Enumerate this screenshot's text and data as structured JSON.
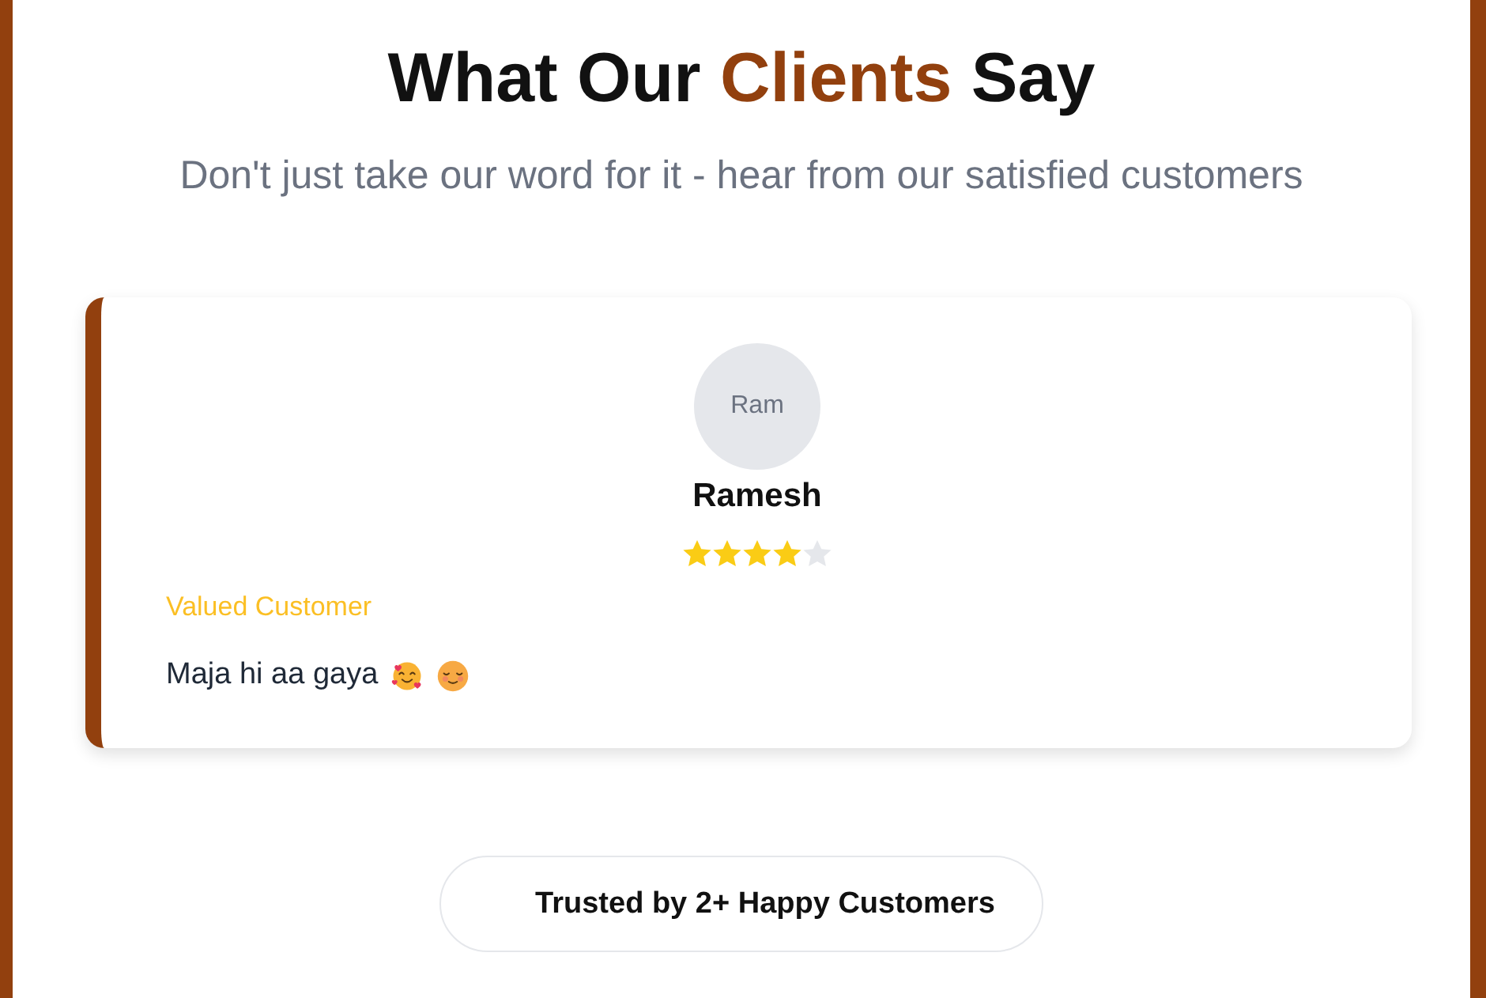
{
  "heading": {
    "start": "What Our",
    "highlight": "Clients",
    "end": "Say"
  },
  "subtitle": "Don't just take our word for it - hear from our satisfied customers",
  "testimonials": [
    {
      "avatar_text": "Ram",
      "name": "Ramesh",
      "stars": 4,
      "role": "Valued Customer",
      "message": "Maja hi aa gaya",
      "emojis": [
        {
          "kind": "hearts"
        },
        {
          "kind": "relieved"
        }
      ]
    }
  ],
  "trust_badge": "Trusted by 2+ Happy Customers"
}
